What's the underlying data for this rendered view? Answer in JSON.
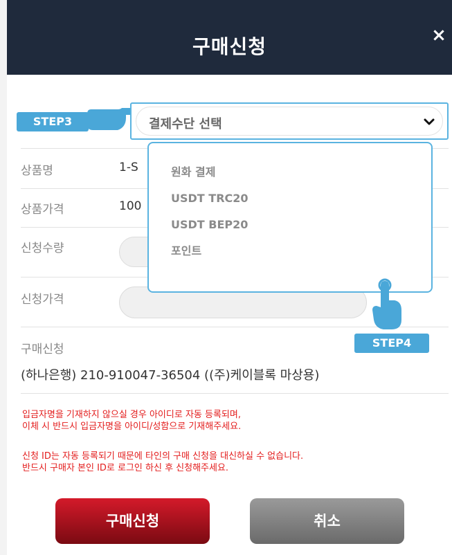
{
  "header": {
    "title": "구매신청",
    "close_label": "×"
  },
  "payment_select": {
    "label": "결제수단 선택",
    "options": [
      "원화 결제",
      "USDT TRC20",
      "USDT BEP20",
      "포인트"
    ]
  },
  "steps": {
    "step3": "STEP3",
    "step4": "STEP4"
  },
  "form": {
    "product_name_label": "상품명",
    "product_name_value": "1-S",
    "product_price_label": "상품가격",
    "product_price_value": "100",
    "quantity_label": "신청수량",
    "apply_price_label": "신청가격"
  },
  "account": {
    "label": "구매신청",
    "info": "(하나은행) 210-910047-36504 ((주)케이블록 마상용)"
  },
  "notices": [
    "입금자명을 기재하지 않으실 경우 아이디로 자동 등록되며,",
    "이체 시 반드시  입금자명을 아이디/성함으로 기재해주세요.",
    "신청 ID는 자동 등록되기 때문에 타인의 구매 신청을 대신하실 수 없습니다.",
    "반드시 구매자 본인 ID로 로그인 하신 후 신청해주세요."
  ],
  "buttons": {
    "buy": "구매신청",
    "cancel": "취소"
  },
  "colors": {
    "header_bg": "#1f2a3c",
    "accent": "#4aa7d8",
    "notice": "#e31c1c",
    "buy_btn": "#b8101e",
    "cancel_btn": "#808080"
  }
}
